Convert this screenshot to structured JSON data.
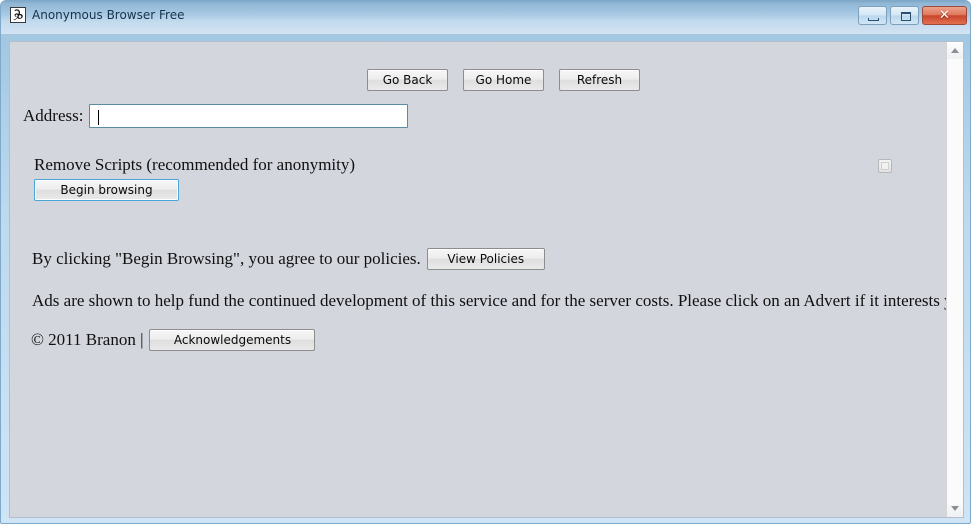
{
  "window": {
    "title": "Anonymous Browser Free",
    "icon": "app-logo-b-icon",
    "controls": {
      "minimize": "Minimize",
      "maximize": "Maximize",
      "close": "✕"
    },
    "colors": {
      "titlebar_top": "#7fa8c6",
      "titlebar_bottom": "#d3e3f2",
      "frame": "#bcd9ee",
      "client_background": "#d4d6de",
      "close_button": "#c9452c",
      "focus_border": "#4aa8d8",
      "input_border": "#5b8ba3"
    }
  },
  "navigation": {
    "go_back": "Go Back",
    "go_home": "Go Home",
    "refresh": "Refresh"
  },
  "address": {
    "label": "Address:",
    "value": "",
    "placeholder": ""
  },
  "options": {
    "remove_scripts_label": "Remove Scripts (recommended for anonymity)",
    "remove_scripts_checked": false
  },
  "actions": {
    "begin_browsing": "Begin browsing"
  },
  "policies": {
    "agreement_text": "By clicking \"Begin Browsing\", you agree to our policies.",
    "view_policies_button": "View Policies"
  },
  "ads": {
    "notice": "Ads are shown to help fund the continued development of this service and for the server costs. Please click on an Advert if it interests you."
  },
  "footer": {
    "copyright": "© 2011 Branon |",
    "acknowledgements_button": "Acknowledgements"
  },
  "scrollbar": {
    "up_arrow": "scroll-up-icon",
    "down_arrow": "scroll-down-icon"
  }
}
